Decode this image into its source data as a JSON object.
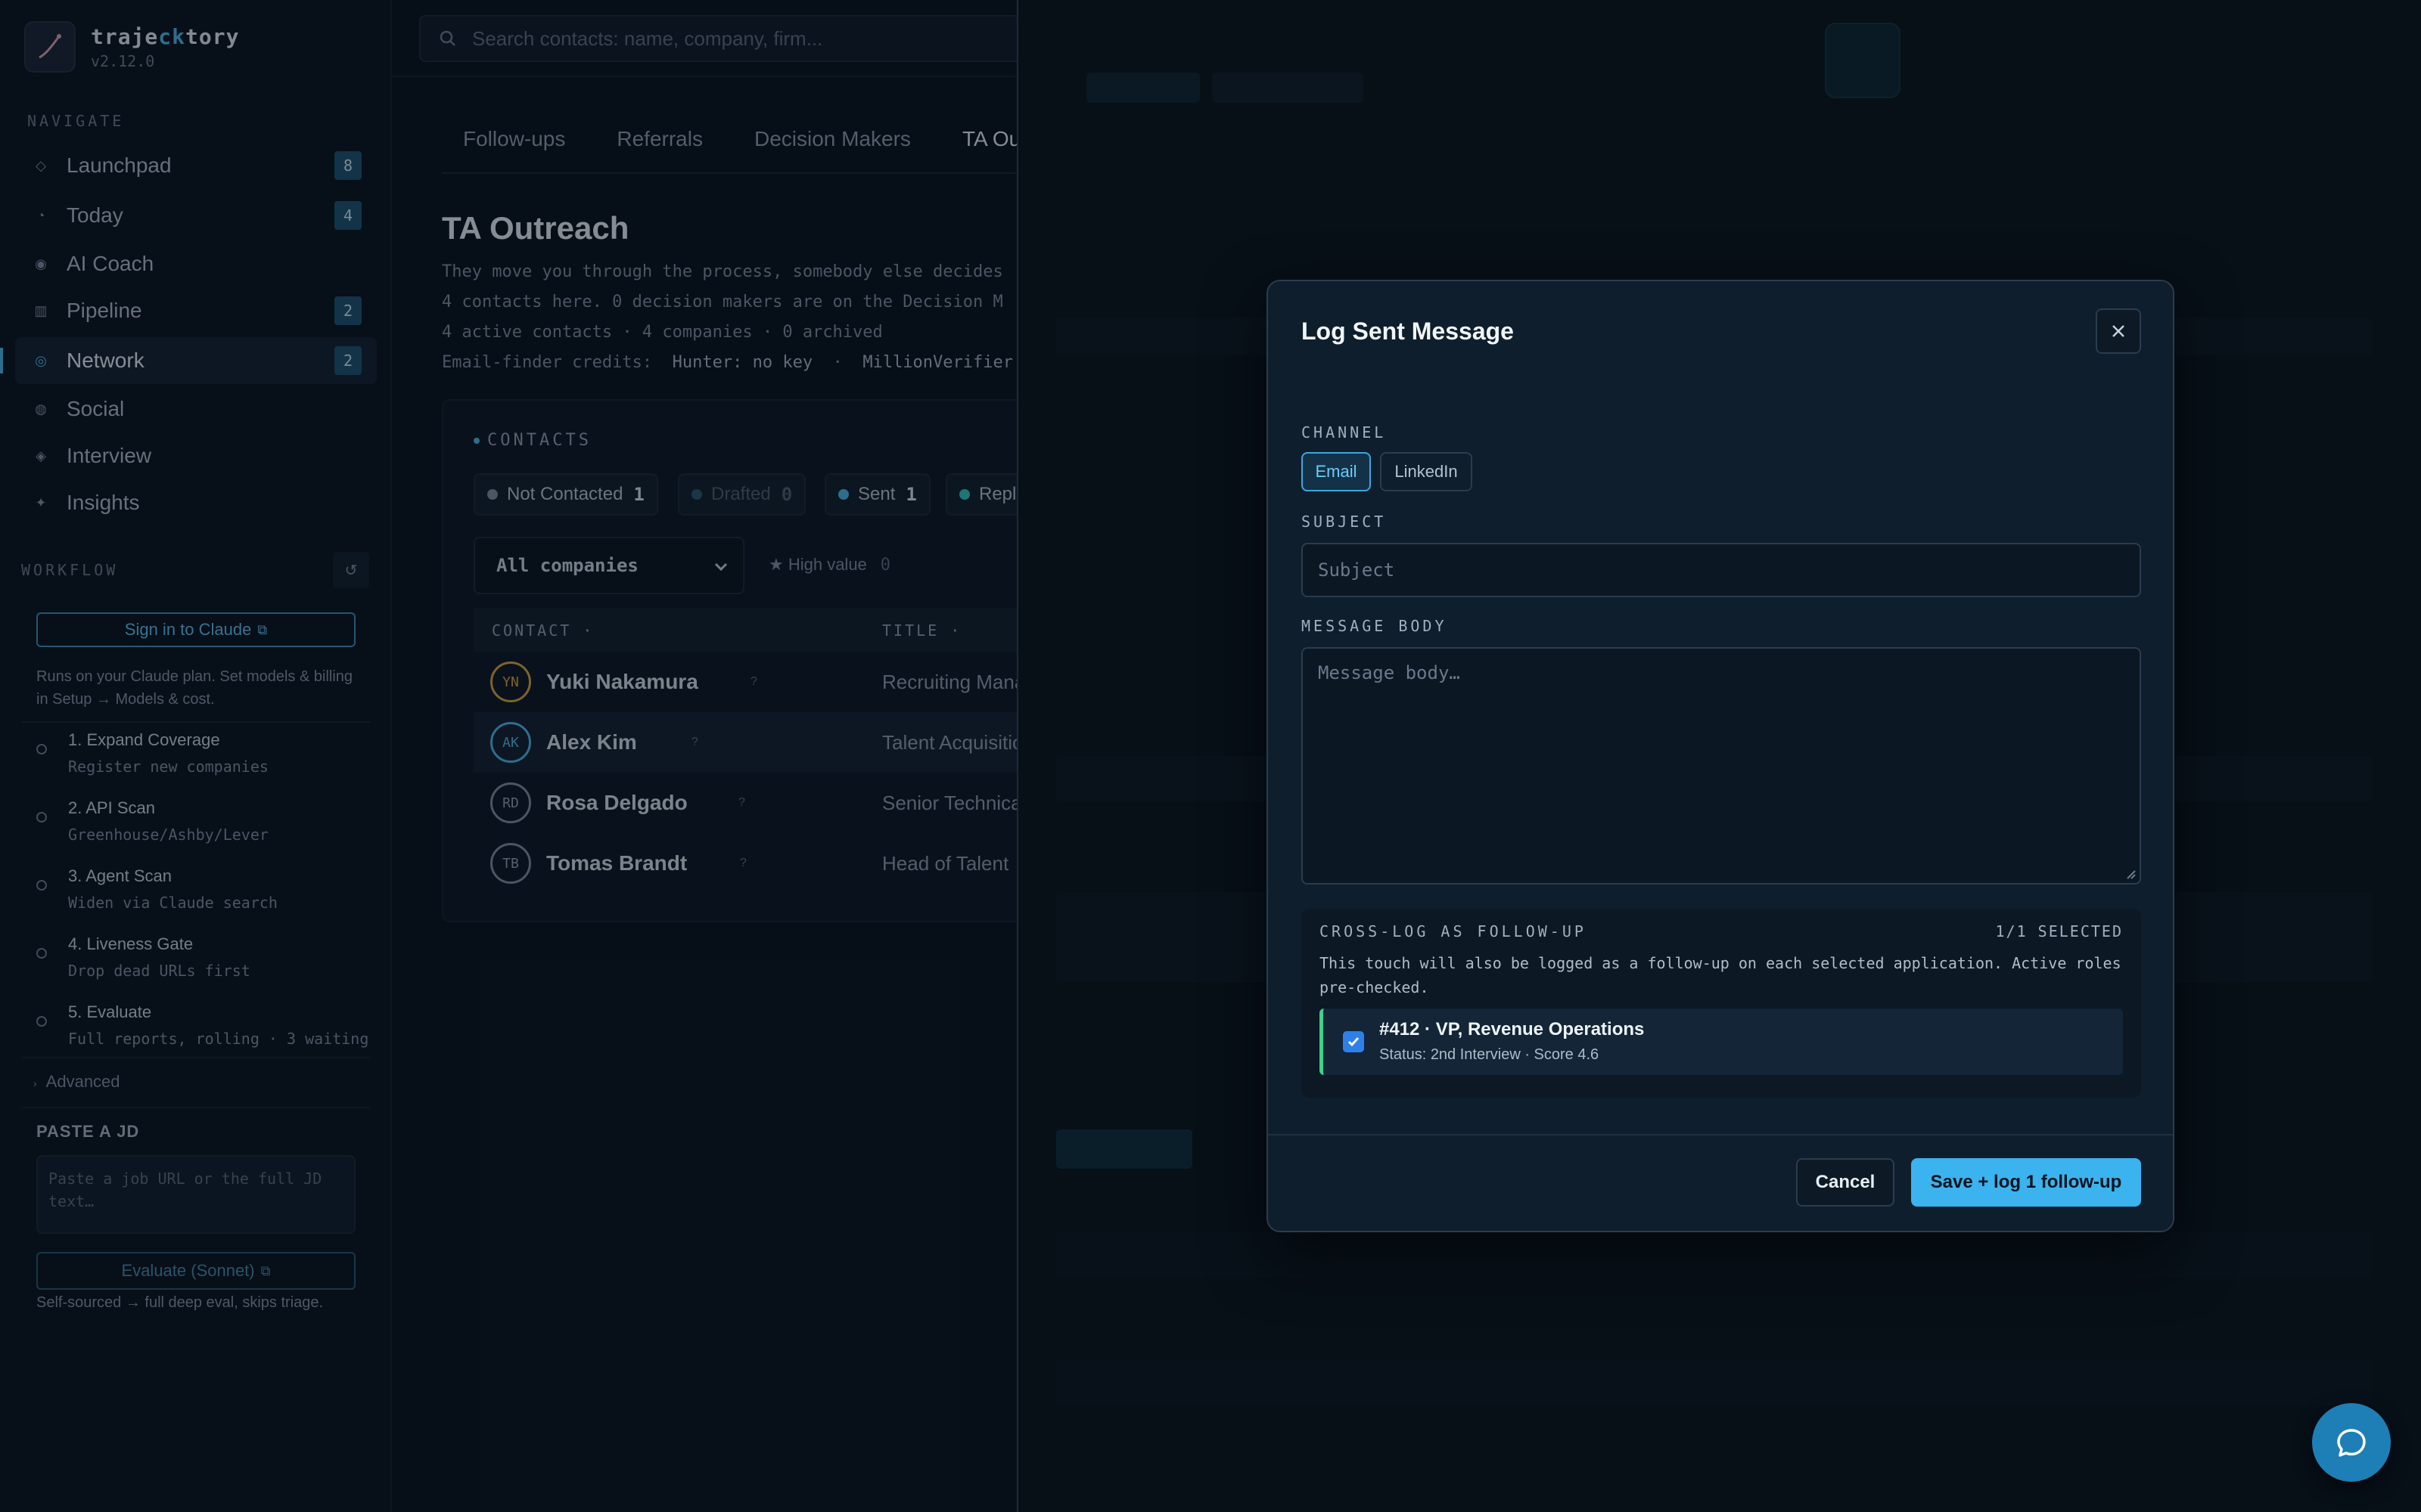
{
  "brand": {
    "name_prefix": "traje",
    "name_accent": "ck",
    "name_suffix": "tory",
    "version": "v2.12.0"
  },
  "sidebar": {
    "navigate_label": "NAVIGATE",
    "items": [
      {
        "label": "Launchpad",
        "badge": "8",
        "icon": "diamond-icon"
      },
      {
        "label": "Today",
        "badge": "4",
        "icon": "clock-icon"
      },
      {
        "label": "AI Coach",
        "badge": "",
        "icon": "target-icon"
      },
      {
        "label": "Pipeline",
        "badge": "2",
        "icon": "columns-icon"
      },
      {
        "label": "Network",
        "badge": "2",
        "icon": "network-icon"
      },
      {
        "label": "Social",
        "badge": "",
        "icon": "circle-icon"
      },
      {
        "label": "Interview",
        "badge": "",
        "icon": "diamond-icon"
      },
      {
        "label": "Insights",
        "badge": "",
        "icon": "sparkle-icon"
      }
    ],
    "workflow_label": "WORKFLOW",
    "signin_label": "Sign in to Claude",
    "signin_note": "Runs on your Claude plan. Set models & billing in Setup → Models & cost.",
    "steps": [
      {
        "title": "1. Expand Coverage",
        "sub": "Register new companies"
      },
      {
        "title": "2. API Scan",
        "sub": "Greenhouse/Ashby/Lever"
      },
      {
        "title": "3. Agent Scan",
        "sub": "Widen via Claude search"
      },
      {
        "title": "4. Liveness Gate",
        "sub": "Drop dead URLs first"
      },
      {
        "title": "5. Evaluate",
        "sub": "Full reports, rolling · 3 waiting"
      }
    ],
    "advanced_label": "Advanced",
    "paste_label": "PASTE A JD",
    "paste_placeholder": "Paste a job URL or the full JD text…",
    "evaluate_label": "Evaluate (Sonnet)",
    "evaluate_note": "Self-sourced → full deep eval, skips triage."
  },
  "main": {
    "search_placeholder": "Search contacts: name, company, firm...",
    "tabs": [
      "Follow-ups",
      "Referrals",
      "Decision Makers",
      "TA Outreach"
    ],
    "title": "TA Outreach",
    "desc_line1": "They move you through the process, somebody else decides",
    "desc_line2": "4 contacts here. 0 decision makers are on the Decision M",
    "desc_line3": "4 active contacts · 4 companies · 0 archived",
    "credits_label": "Email-finder credits:",
    "credits_hunter": "Hunter: no key",
    "credits_mv": "MillionVerifier",
    "contacts_label": "CONTACTS",
    "chips": [
      {
        "label": "Not Contacted",
        "count": "1",
        "color": "#7f8fa0"
      },
      {
        "label": "Drafted",
        "count": "0",
        "color": "#2b5a6e"
      },
      {
        "label": "Sent",
        "count": "1",
        "color": "#4fb8e8"
      },
      {
        "label": "Replied",
        "count": "",
        "color": "#33c7c2"
      }
    ],
    "company_filter": "All companies",
    "high_value_label": "★ High value",
    "high_value_count": "0",
    "col_contact": "CONTACT ·",
    "col_title": "TITLE ·",
    "rows": [
      {
        "initials": "YN",
        "name": "Yuki Nakamura",
        "title": "Recruiting Manager",
        "ring": "#d9a441"
      },
      {
        "initials": "AK",
        "name": "Alex Kim",
        "title": "Talent Acquisition",
        "ring": "#4fb8e8"
      },
      {
        "initials": "RD",
        "name": "Rosa Delgado",
        "title": "Senior Technical",
        "ring": "#7f8fa0"
      },
      {
        "initials": "TB",
        "name": "Tomas Brandt",
        "title": "Head of Talent",
        "ring": "#7f8fa0"
      }
    ]
  },
  "modal": {
    "title": "Log Sent Message",
    "channel_label": "CHANNEL",
    "channel_email": "Email",
    "channel_linkedin": "LinkedIn",
    "subject_label": "SUBJECT",
    "subject_placeholder": "Subject",
    "body_label": "MESSAGE BODY",
    "body_placeholder": "Message body…",
    "crosslog_label": "CROSS-LOG AS FOLLOW-UP",
    "crosslog_count": "1/1 SELECTED",
    "crosslog_desc": "This touch will also be logged as a follow-up on each selected application. Active roles pre-checked.",
    "app_title": "#412 · VP, Revenue Operations",
    "app_status": "Status: 2nd Interview · Score 4.6",
    "cancel_label": "Cancel",
    "save_label": "Save + log 1 follow-up"
  },
  "colors": {
    "accent": "#3bb3ee",
    "background": "#0a141f",
    "success": "#3fd08a"
  }
}
